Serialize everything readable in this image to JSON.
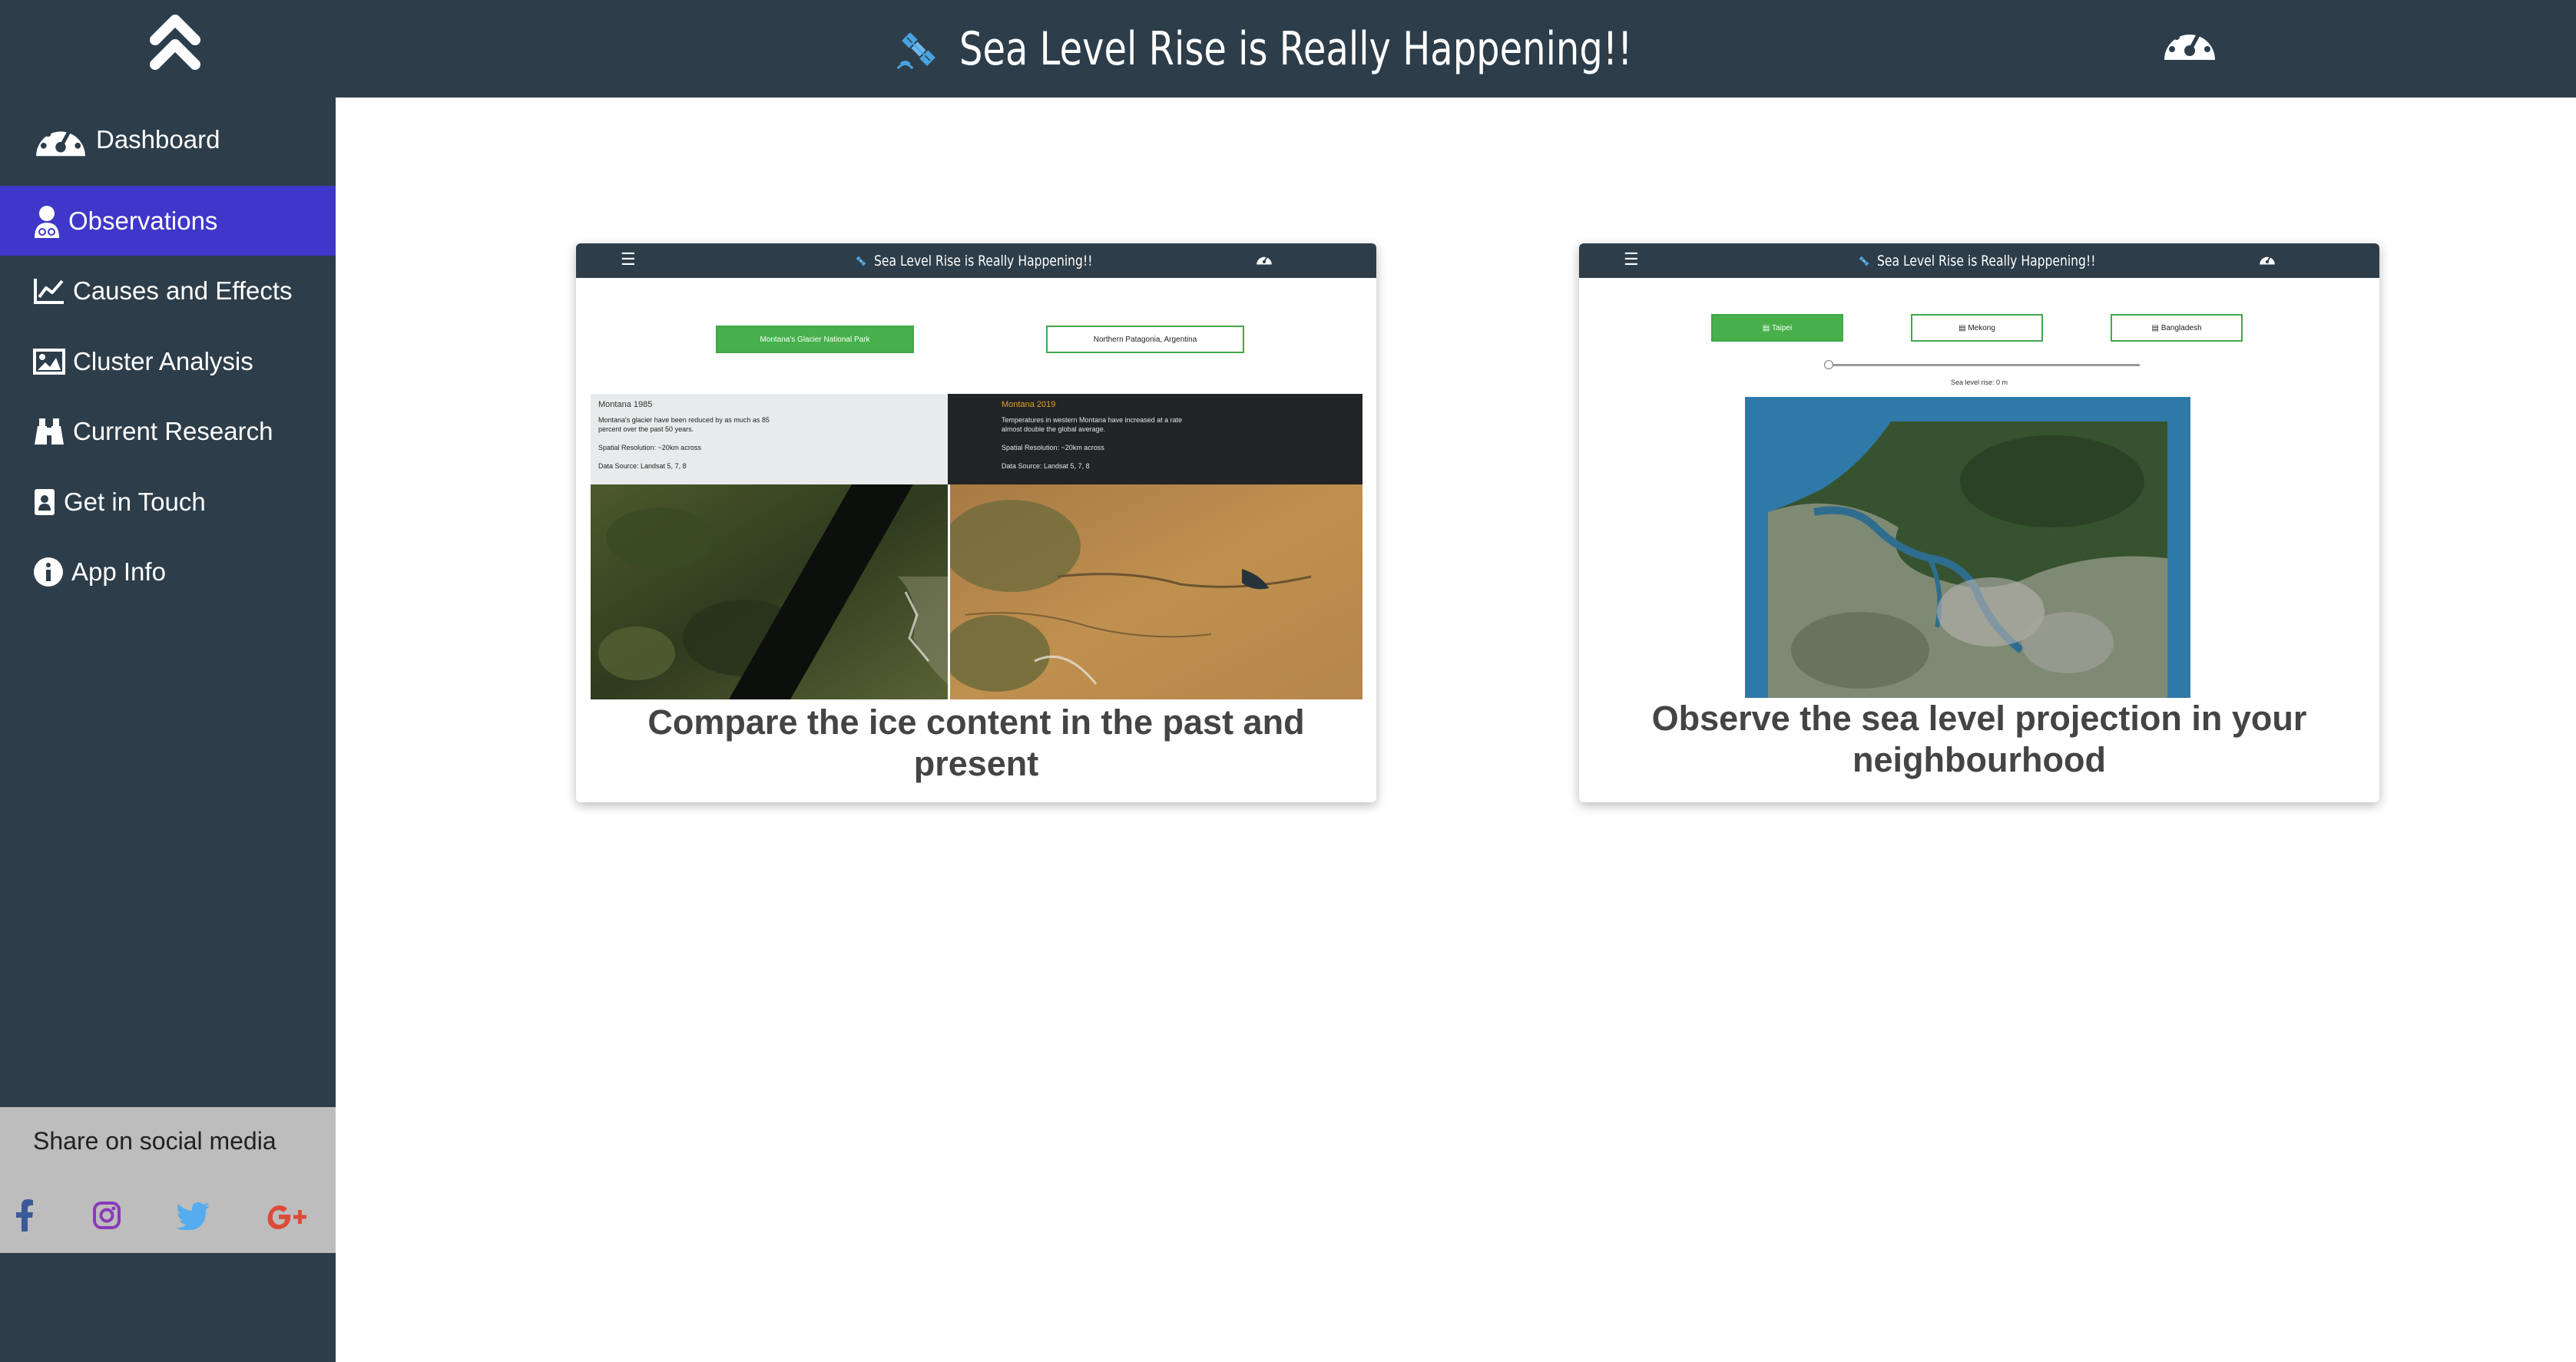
{
  "header": {
    "title": "Sea Level Rise is Really Happening!!",
    "collapse_icon": "double-chevron-up-icon",
    "title_icon": "satellite-icon",
    "dashboard_icon": "speedometer-icon"
  },
  "sidebar": {
    "items": [
      {
        "label": "Dashboard",
        "icon": "speedometer-icon",
        "active": false
      },
      {
        "label": "Observations",
        "icon": "user-md-icon",
        "active": true
      },
      {
        "label": "Causes and Effects",
        "icon": "line-chart-icon",
        "active": false
      },
      {
        "label": "Cluster Analysis",
        "icon": "image-icon",
        "active": false
      },
      {
        "label": "Current Research",
        "icon": "binoculars-icon",
        "active": false
      },
      {
        "label": "Get in Touch",
        "icon": "contact-card-icon",
        "active": false
      },
      {
        "label": "App Info",
        "icon": "info-circle-icon",
        "active": false
      }
    ],
    "share": {
      "title": "Share on social media",
      "networks": [
        "facebook",
        "instagram",
        "twitter",
        "google-plus"
      ]
    }
  },
  "cards": [
    {
      "caption_line1": "Compare the ice content in the past and",
      "caption_line2": "present",
      "preview": {
        "title": "Sea Level Rise is Really Happening!!",
        "buttons": [
          "Montana's Glacier National Park",
          "Northern Patagonia, Argentina"
        ],
        "left_panel": {
          "heading": "Montana 1985",
          "text1": "Montana's glacier have been reduced by as much as 85",
          "text2": "percent over the past 50 years.",
          "text3": "Spatial Resolution: ~20km across",
          "text4": "Data Source: Landsat 5, 7, 8"
        },
        "right_panel": {
          "heading": "Montana 2019",
          "text1": "Temperatures in western Montana have increased at a rate",
          "text2": "almost double the global average.",
          "text3": "Spatial Resolution: ~20km across",
          "text4": "Data Source: Landsat 5, 7, 8"
        }
      }
    },
    {
      "caption_line1": "Observe the sea level projection in your",
      "caption_line2": "neighbourhood",
      "preview": {
        "title": "Sea Level Rise is Really Happening!!",
        "buttons": [
          "Taipei",
          "Mekong",
          "Bangladesh"
        ],
        "slider_label": "Sea level rise: 0 m",
        "slider_value": 0
      }
    }
  ],
  "colors": {
    "topbar": "#2d3d4a",
    "active_nav": "#3f37c9",
    "share_bg": "#bdbdbd",
    "green_button": "#47b04b",
    "satellite_icon": "#4aa3e0",
    "facebook": "#3b5998",
    "instagram": "#8a3ab9",
    "twitter": "#55acee",
    "google_plus": "#dd4b39"
  }
}
